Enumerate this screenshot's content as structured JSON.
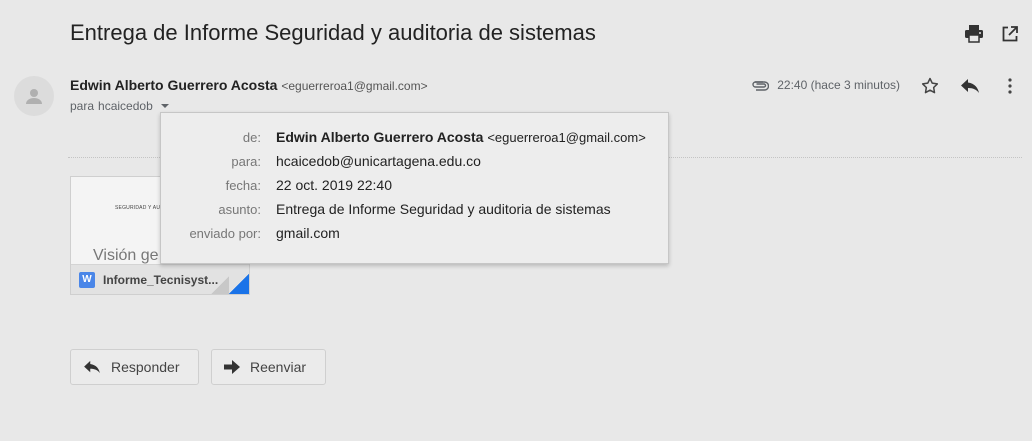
{
  "subject": "Entrega de Informe Seguridad y auditoria de sistemas",
  "toolbar": {
    "print_icon": "printer-icon",
    "popout_icon": "open-in-new-icon"
  },
  "message": {
    "sender_name": "Edwin Alberto Guerrero Acosta",
    "sender_email": "<eguerreroa1@gmail.com>",
    "to_prefix": "para",
    "to_recipient": "hcaicedob",
    "time": "22:40 (hace 3 minutos)"
  },
  "details": {
    "from_label": "de:",
    "from_name": "Edwin Alberto Guerrero Acosta",
    "from_email": "<eguerreroa1@gmail.com>",
    "to_label": "para:",
    "to_value": "hcaicedob@unicartagena.edu.co",
    "date_label": "fecha:",
    "date_value": "22 oct. 2019 22:40",
    "subject_label": "asunto:",
    "subject_value": "Entrega de Informe Seguridad y auditoria de sistemas",
    "sent_by_label": "enviado por:",
    "sent_by_value": "gmail.com"
  },
  "attachment": {
    "preview_title": "SEGURIDAD Y AUDITORIA",
    "preview_text": "Visión ge",
    "type_letter": "W",
    "filename": "Informe_Tecnisyst..."
  },
  "actions": {
    "reply_label": "Responder",
    "forward_label": "Reenviar"
  },
  "colors": {
    "accent": "#1a73e8",
    "word": "#4a86e8"
  }
}
